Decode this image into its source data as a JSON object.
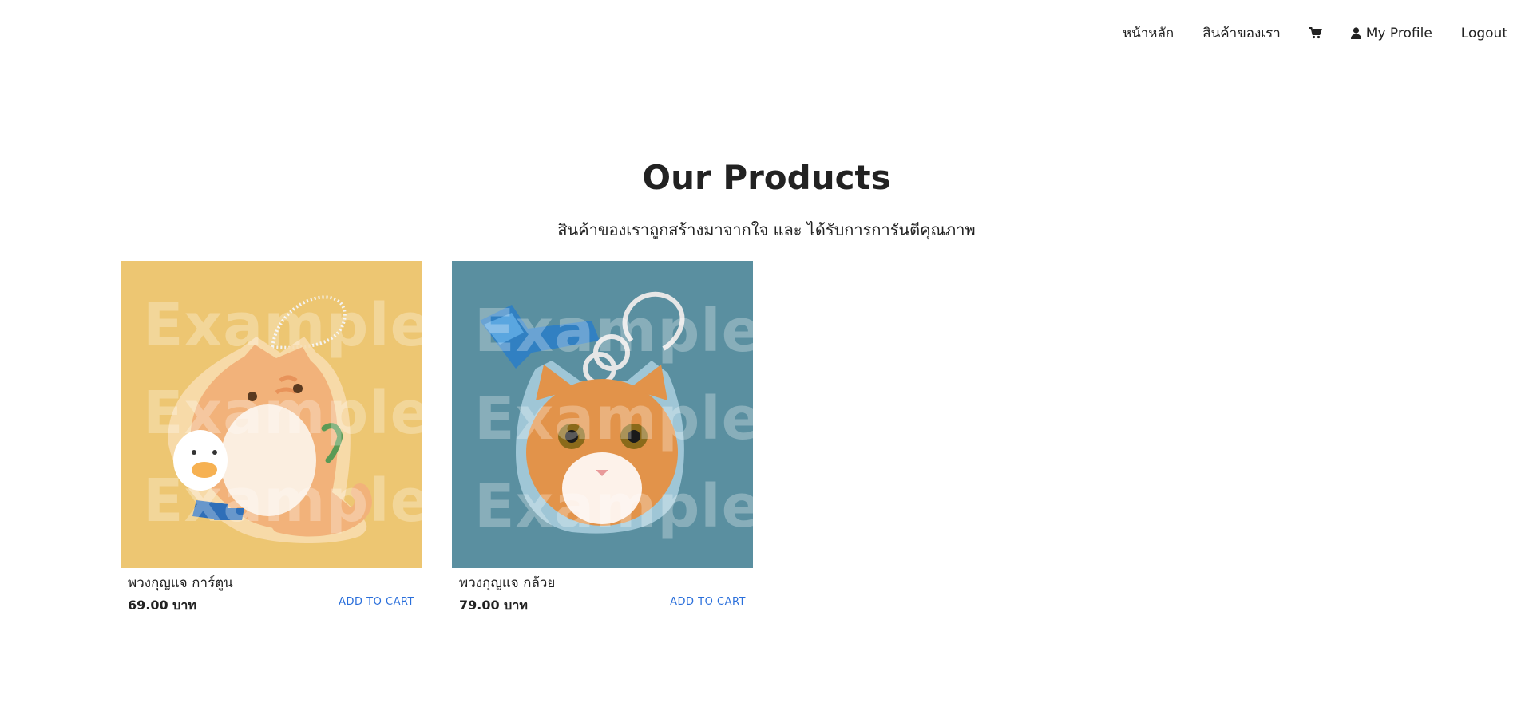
{
  "nav": {
    "home": "หน้าหลัก",
    "products": "สินค้าของเรา",
    "cart_icon": "cart-icon",
    "user_icon": "user-icon",
    "profile": "My Profile",
    "logout": "Logout"
  },
  "header": {
    "title": "Our Products",
    "subtitle": "สินค้าของเราถูกสร้างมาจากใจ และ ได้รับการการันตีคุณภาพ"
  },
  "products": [
    {
      "name": "พวงกุญแจ การ์ตูน",
      "price": "69.00 บาท",
      "cta": "ADD TO CART",
      "watermark": "Example",
      "bg_color": "#edc672"
    },
    {
      "name": "พวงกุญแจ กล้วย",
      "price": "79.00 บาท",
      "cta": "ADD TO CART",
      "watermark": "Example",
      "bg_color": "#5a8fa0"
    }
  ],
  "colors": {
    "text": "#222222",
    "link": "#2a6fdb"
  }
}
